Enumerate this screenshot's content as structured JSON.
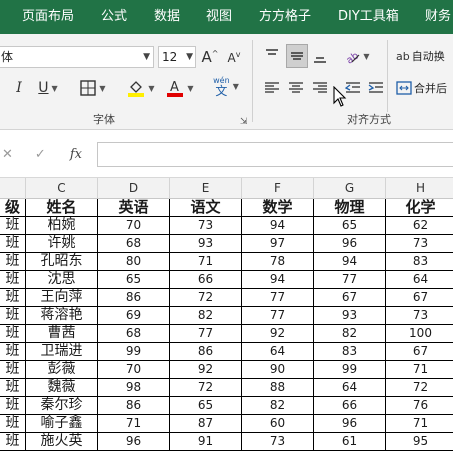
{
  "ribbon_tabs": [
    "页面布局",
    "公式",
    "数据",
    "视图",
    "方方格子",
    "DIY工具箱",
    "财务"
  ],
  "font": {
    "name": "体",
    "size": "12"
  },
  "groups": {
    "font_label": "字体",
    "align_label": "对齐方式"
  },
  "phonetic_label": {
    "top": "wén",
    "bottom": "文"
  },
  "buttons": {
    "wrap_text": "自动换",
    "merge_center": "合并后"
  },
  "colors": {
    "highlight": "#ffef00",
    "font_color": "#e00000",
    "ribbon_green": "#217346"
  },
  "formula_bar": {
    "fx": "fx",
    "value": ""
  },
  "grid": {
    "columns": [
      "",
      "C",
      "D",
      "E",
      "F",
      "G",
      "H"
    ],
    "headers": [
      "级",
      "姓名",
      "英语",
      "语文",
      "数学",
      "物理",
      "化学"
    ],
    "rows": [
      [
        "班",
        "柏婉",
        "70",
        "73",
        "94",
        "65",
        "62"
      ],
      [
        "班",
        "许姚",
        "68",
        "93",
        "97",
        "96",
        "73"
      ],
      [
        "班",
        "孔昭东",
        "80",
        "71",
        "78",
        "94",
        "83"
      ],
      [
        "班",
        "沈思",
        "65",
        "66",
        "94",
        "77",
        "64"
      ],
      [
        "班",
        "王向萍",
        "86",
        "72",
        "77",
        "67",
        "67"
      ],
      [
        "班",
        "蒋溶艳",
        "69",
        "82",
        "77",
        "93",
        "73"
      ],
      [
        "班",
        "曹茜",
        "68",
        "77",
        "92",
        "82",
        "100"
      ],
      [
        "班",
        "卫瑞进",
        "99",
        "86",
        "64",
        "83",
        "67"
      ],
      [
        "班",
        "彭薇",
        "70",
        "92",
        "90",
        "99",
        "71"
      ],
      [
        "班",
        "魏薇",
        "98",
        "72",
        "88",
        "64",
        "72"
      ],
      [
        "班",
        "秦尔珍",
        "86",
        "65",
        "82",
        "66",
        "76"
      ],
      [
        "班",
        "喻子鑫",
        "71",
        "87",
        "60",
        "96",
        "71"
      ],
      [
        "班",
        "施火英",
        "96",
        "91",
        "73",
        "61",
        "95"
      ]
    ]
  }
}
